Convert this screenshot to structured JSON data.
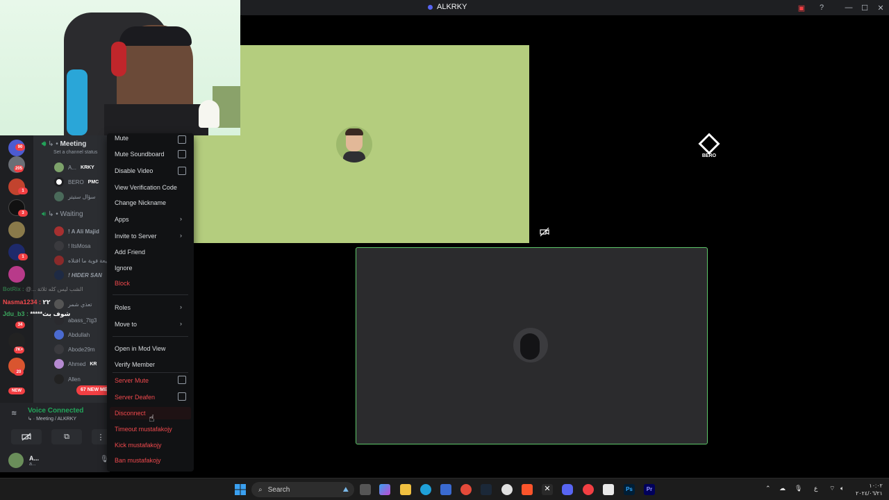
{
  "window": {
    "title": "ALKRKY"
  },
  "stage": {
    "remote_user_label": "BERO"
  },
  "channels": {
    "meeting": {
      "name": "Meeting",
      "status_placeholder": "Set a channel status"
    },
    "waiting": {
      "name": "Waiting"
    },
    "meeting_members": [
      {
        "name": "A...",
        "tag": "KRKY"
      },
      {
        "name": "BERO",
        "tag": "PMC"
      },
      {
        "name": "سؤال ستيتر",
        "tag": ""
      }
    ],
    "waiting_members": [
      {
        "name": "! A Ali Majid",
        "tag": ""
      },
      {
        "name": "! ItsMosa",
        "tag": ""
      },
      {
        "name": "شيعة فوية ما اقتلاه",
        "tag": ""
      },
      {
        "name": "! HIDER SAN",
        "tag": ""
      },
      {
        "name": "تعذي شمر",
        "tag": ""
      },
      {
        "name": "abass_7tg3",
        "tag": ""
      },
      {
        "name": "Abdullah",
        "tag": ""
      },
      {
        "name": "Abode29m",
        "tag": ""
      },
      {
        "name": "Ahmed",
        "tag": "KR"
      },
      {
        "name": "Allen",
        "tag": ""
      }
    ]
  },
  "server_badges": [
    "90",
    "205",
    "1",
    "3",
    "1",
    "34",
    "7K+",
    "20",
    "NEW"
  ],
  "chat_overlay": [
    {
      "user": "BotRix",
      "text": "@... الشب ليس كله ثلاثة",
      "color": "#3ba55d"
    },
    {
      "user": "Nasma1234",
      "text": "٢٢",
      "color": "#f0494d"
    },
    {
      "user": "Jdu_b3",
      "text": "*****شوف بث",
      "color": "#3ba55d"
    }
  ],
  "new_messages": "67 NEW MESSAGES",
  "voice_panel": {
    "status": "Voice Connected",
    "location": "Meeting / ALKRKY",
    "user_name": "A...",
    "user_status": "a..."
  },
  "context_menu": {
    "items": [
      {
        "label": "Mute",
        "kind": "check",
        "danger": false
      },
      {
        "label": "Mute Soundboard",
        "kind": "check",
        "danger": false
      },
      {
        "label": "Disable Video",
        "kind": "check",
        "danger": false
      },
      {
        "label": "View Verification Code",
        "kind": "plain",
        "danger": false
      },
      {
        "label": "Change Nickname",
        "kind": "plain",
        "danger": false
      },
      {
        "label": "Apps",
        "kind": "submenu",
        "danger": false
      },
      {
        "label": "Invite to Server",
        "kind": "submenu",
        "danger": false
      },
      {
        "label": "Add Friend",
        "kind": "plain",
        "danger": false
      },
      {
        "label": "Ignore",
        "kind": "plain",
        "danger": false
      },
      {
        "label": "Block",
        "kind": "plain",
        "danger": true
      },
      {
        "label": "Roles",
        "kind": "submenu",
        "danger": false
      },
      {
        "label": "Move to",
        "kind": "submenu",
        "danger": false
      },
      {
        "label": "Open in Mod View",
        "kind": "plain",
        "danger": false
      },
      {
        "label": "Verify Member",
        "kind": "plain",
        "danger": false
      },
      {
        "label": "Server Mute",
        "kind": "check",
        "danger": true
      },
      {
        "label": "Server Deafen",
        "kind": "check",
        "danger": true
      },
      {
        "label": "Disconnect",
        "kind": "plain",
        "danger": true
      },
      {
        "label": "Timeout mustafakojy",
        "kind": "plain",
        "danger": true
      },
      {
        "label": "Kick mustafakojy",
        "kind": "plain",
        "danger": true
      },
      {
        "label": "Ban mustafakojy",
        "kind": "plain",
        "danger": true
      }
    ]
  },
  "taskbar": {
    "search_placeholder": "Search",
    "tray_lang": "ع",
    "clock_time": "١٠:٠٢",
    "clock_date": "٢٠٢٤/٠٦/٢١"
  },
  "colors": {
    "accent_green": "#23a55a",
    "danger": "#f0494d",
    "stage_green": "#b4cd7e"
  }
}
